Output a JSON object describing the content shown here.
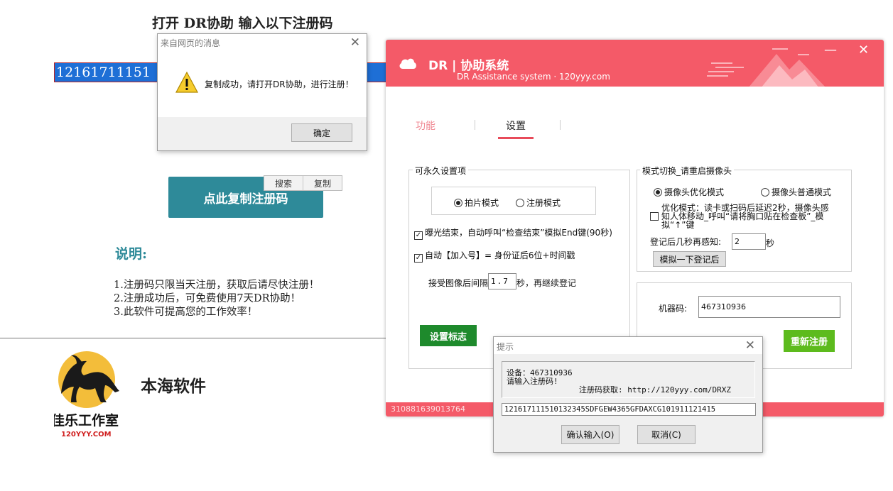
{
  "webpage": {
    "heading": "打开 DR协助 输入以下注册码",
    "reg_code_visible": "12161711151",
    "copy_button": "点此复制注册码",
    "context_menu": {
      "search": "搜索",
      "copy": "复制"
    },
    "notes_title": "说明:",
    "notes": [
      "1.注册码只限当天注册，获取后请尽快注册！",
      "2.注册成功后，可免费使用7天DR协助！",
      "3.此软件可提高您的工作效率！"
    ],
    "company_name": "本海软件",
    "logo": {
      "name": "佳乐工作室",
      "url": "120YYY.COM"
    }
  },
  "message_box": {
    "title": "来自网页的消息",
    "text": "复制成功，请打开DR协助，进行注册！",
    "ok": "确定",
    "icon": "warning-icon"
  },
  "app": {
    "title": "DR | 协助系统",
    "subtitle": "DR Assistance system · 120yyy.com",
    "tabs": {
      "function": "功能",
      "settings": "设置"
    },
    "permanent_group": {
      "label": "可永久设置项",
      "mode_photo": "拍片模式",
      "mode_register": "注册模式",
      "exposure": "曝光结束，自动呼叫“检查结束”模拟End键(90秒)",
      "auto_add": "自动【加入号】= 身份证后6位+时间戳",
      "interval_prefix": "接受图像后间隔",
      "interval_value": "1.7",
      "interval_suffix": "秒，再继续登记",
      "set_flag": "设置标志"
    },
    "camera_group": {
      "label": "模式切换_请重启摄像头",
      "optimized": "摄像头优化模式",
      "normal": "摄像头普通模式",
      "hint_line1": "优化模式：读卡或扫码后延迟2秒，摄像头感",
      "hint_line2": "知人体移动_呼叫“请将胸口贴在检查板”_模",
      "hint_line3": "拟“↑”键",
      "sense_label": "登记后几秒再感知:",
      "sense_value": "2",
      "sense_unit": "秒",
      "simulate": "模拟一下登记后"
    },
    "machine": {
      "label": "机器码:",
      "value": "467310936",
      "rereg": "重新注册"
    },
    "footer_code": "310881639013764",
    "colors": {
      "header": "#f45a68",
      "green": "#1e8a2c",
      "lime": "#5dbb1d"
    }
  },
  "prompt": {
    "title": "提示",
    "device": "设备：467310936",
    "ask": "请输入注册码!",
    "get_code": "注册码获取: http://120yyy.com/DRXZ",
    "input_value": "121617111510132345SDFGEW4365GFDAXCG101911121415",
    "confirm": "确认输入(O)",
    "cancel": "取消(C)"
  }
}
